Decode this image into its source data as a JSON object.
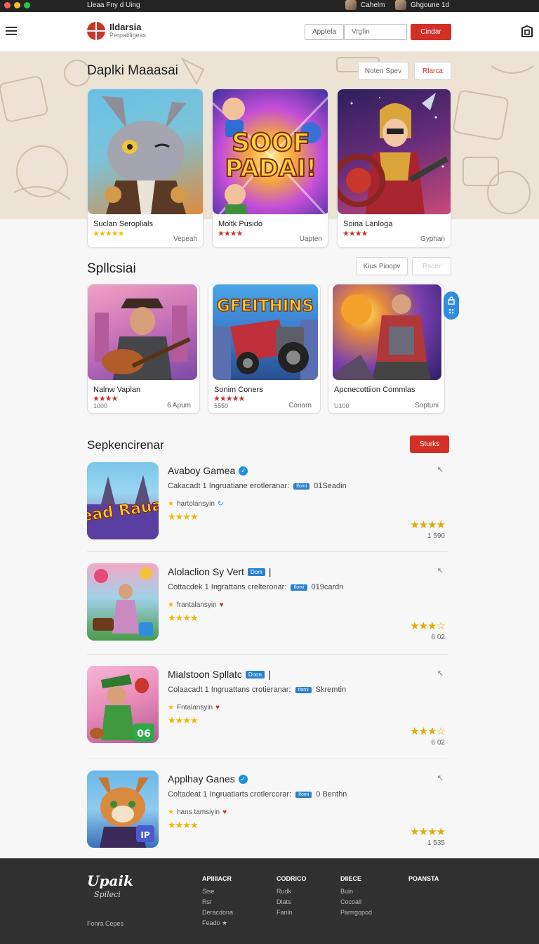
{
  "system_bar": {
    "title": "Lleaa Fny d Uing",
    "users": [
      "Cahelm",
      "Ghgoune 1d"
    ],
    "dot_colors": [
      "#ff5f57",
      "#febc2e",
      "#28c840"
    ]
  },
  "header": {
    "logo_name": "Ildarsia",
    "logo_tagline": "Perpatiligeas",
    "apply_label": "Apptela",
    "search_placeholder": "Vrgfin",
    "cta_label": "Cindar"
  },
  "featured": {
    "title": "Daplki Maaasai",
    "filter_label": "Noten Spev",
    "action_label": "Rlarca",
    "cards": [
      {
        "name": "Suclan Seroplials",
        "stars": "★★★★★",
        "meta": "Vepeah"
      },
      {
        "name": "Moitk Pusido",
        "stars": "★★★★",
        "meta": "Uapten"
      },
      {
        "name": "Soina Lanloga",
        "stars": "★★★★",
        "meta": "Gyphan"
      }
    ],
    "card2_art_text": [
      "SOOF",
      "PADAI!"
    ]
  },
  "spotlight": {
    "title": "Spllcsiai",
    "filter_label": "Kius Pioopv",
    "action_label": "Rscer",
    "cards": [
      {
        "name": "Nalnw Vaplan",
        "stars": "★★★★",
        "num": "1000",
        "meta": "6 Apum"
      },
      {
        "name": "Sonim Coners",
        "stars": "★★★★★",
        "num": "5550",
        "meta": "Conarn"
      },
      {
        "name": "Apcnecottiion Commlas",
        "stars": "",
        "num": "U100",
        "meta": "Soptuni"
      }
    ],
    "card2_art_text": "GFEITHINS"
  },
  "list": {
    "title": "Sepkencirenar",
    "action_label": "Sturks",
    "items": [
      {
        "title": "Avaboy Gamea",
        "badge": "",
        "verified": true,
        "desc": "Cakacadt 1 Ingruatiane erotleranar:",
        "tag": "Ifomi",
        "extra": "01Seadin",
        "meta": "hartolansyin",
        "stars": "★★★★",
        "rstars": "★★★★",
        "rnum": "1 590",
        "art_text": "Sead Rauak"
      },
      {
        "title": "Alolaclion Sy Vert",
        "badge": "Dom",
        "verified": false,
        "desc": "Cottacdek 1 Ingrattans crelteronar:",
        "tag": "Ifomi",
        "extra": "019cardn",
        "meta": "frantalansyin",
        "stars": "★★★★",
        "rstars": "★★★☆",
        "rnum": "6 02",
        "art_text": ""
      },
      {
        "title": "Mialstoon Spllatc",
        "badge": "Doon",
        "verified": false,
        "desc": "Colaacadt 1 Ingruattans crotieranar:",
        "tag": "Ifomi",
        "extra": "Skremtin",
        "meta": "Fntalansyin",
        "stars": "★★★★",
        "rstars": "★★★☆",
        "rnum": "6 02",
        "art_text": "06"
      },
      {
        "title": "Applhay Ganes",
        "badge": "",
        "verified": true,
        "desc": "Coltadeat 1 Ingruatiarts crotlercorar:",
        "tag": "Ifomi",
        "extra": "0 Benthn",
        "meta": "hans tamsiyin",
        "stars": "★★★★",
        "rstars": "★★★★",
        "rnum": "1 535",
        "art_text": "IP"
      }
    ]
  },
  "footer": {
    "logo_main": "Upaik",
    "logo_sub": "Spileci",
    "copyright": "Fonra Cepes",
    "columns": [
      {
        "heading": "APIIIIACR",
        "links": [
          "Sise",
          "Rsr",
          "Deracdona",
          "Feado ★"
        ]
      },
      {
        "heading": "CODRICO",
        "links": [
          "Rudk",
          "Dlats",
          "Fanln"
        ]
      },
      {
        "heading": "DIIECE",
        "links": [
          "Buin",
          "Cocoall",
          "Parrrgopod"
        ]
      },
      {
        "heading": "POANSTA",
        "links": []
      }
    ]
  },
  "colors": {
    "accent": "#d22f27",
    "badge": "#2a7fd0",
    "star": "#f2b705",
    "hero_bg": "#ece3d4"
  }
}
